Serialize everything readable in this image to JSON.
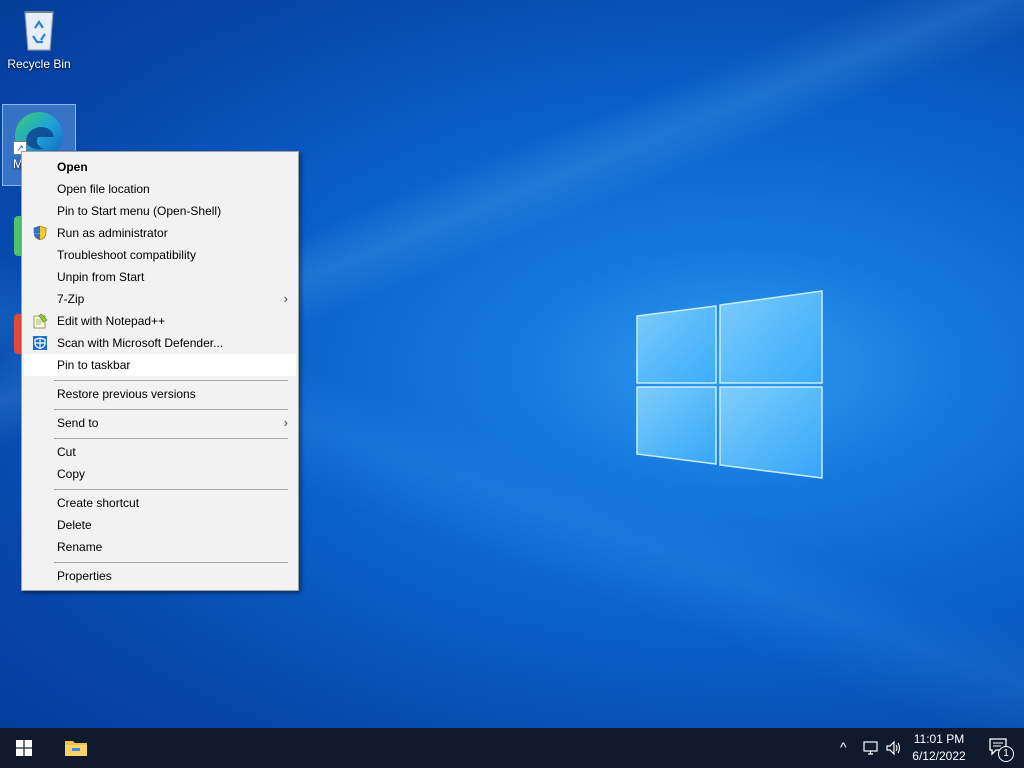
{
  "desktop": {
    "icons": [
      {
        "label": "Recycle Bin",
        "icon": "recycle-bin-icon"
      },
      {
        "label": "M",
        "icon": "edge-icon"
      }
    ]
  },
  "context_menu": {
    "items": [
      {
        "label": "Open",
        "bold": true
      },
      {
        "label": "Open file location"
      },
      {
        "label": "Pin to Start menu (Open-Shell)"
      },
      {
        "label": "Run as administrator",
        "icon": "uac-shield-icon"
      },
      {
        "label": "Troubleshoot compatibility"
      },
      {
        "label": "Unpin from Start"
      },
      {
        "label": "7-Zip",
        "submenu": true
      },
      {
        "label": "Edit with Notepad++",
        "icon": "notepad-plus-plus-icon"
      },
      {
        "label": "Scan with Microsoft Defender...",
        "icon": "defender-icon"
      },
      {
        "label": "Pin to taskbar",
        "highlighted": true
      },
      {
        "label": "Restore previous versions"
      },
      {
        "label": "Send to",
        "submenu": true
      },
      {
        "label": "Cut"
      },
      {
        "label": "Copy"
      },
      {
        "label": "Create shortcut"
      },
      {
        "label": "Delete"
      },
      {
        "label": "Rename"
      },
      {
        "label": "Properties"
      }
    ],
    "submenu_arrow": "›"
  },
  "taskbar": {
    "clock_time": "11:01 PM",
    "clock_date": "6/12/2022",
    "notification_count": "1",
    "tray": {
      "chevron": "^"
    }
  },
  "colors": {
    "taskbar": "#0f1a2d",
    "menu_bg": "#f2f2f2",
    "menu_highlight": "#ffffff"
  }
}
